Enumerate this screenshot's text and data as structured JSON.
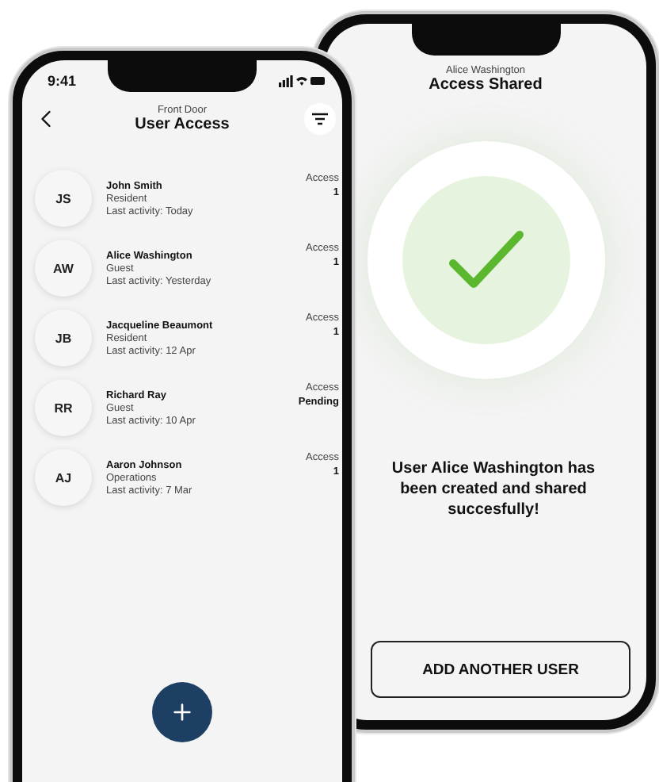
{
  "list_screen": {
    "status_time": "9:41",
    "subtitle": "Front Door",
    "title": "User Access",
    "users": [
      {
        "initials": "JS",
        "name": "John Smith",
        "role": "Resident",
        "last_activity": "Last activity: Today",
        "access_label": "Access",
        "access_value": "1"
      },
      {
        "initials": "AW",
        "name": "Alice Washington",
        "role": "Guest",
        "last_activity": "Last activity: Yesterday",
        "access_label": "Access",
        "access_value": "1"
      },
      {
        "initials": "JB",
        "name": "Jacqueline Beaumont",
        "role": "Resident",
        "last_activity": "Last activity: 12 Apr",
        "access_label": "Access",
        "access_value": "1"
      },
      {
        "initials": "RR",
        "name": "Richard Ray",
        "role": "Guest",
        "last_activity": "Last activity: 10 Apr",
        "access_label": "Access",
        "access_value": "Pending"
      },
      {
        "initials": "AJ",
        "name": "Aaron Johnson",
        "role": "Operations",
        "last_activity": "Last activity: 7 Mar",
        "access_label": "Access",
        "access_value": "1"
      }
    ]
  },
  "shared_screen": {
    "subtitle": "Alice Washington",
    "title": "Access Shared",
    "message": "User Alice Washington has been created and shared succesfully!",
    "button": "ADD ANOTHER USER"
  }
}
